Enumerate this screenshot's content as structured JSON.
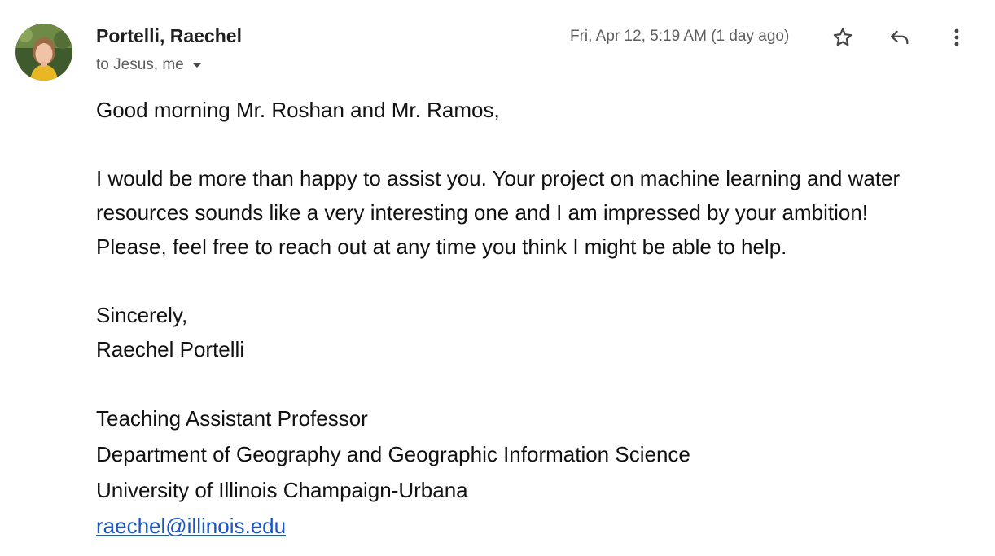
{
  "message": {
    "sender": {
      "name": "Portelli, Raechel",
      "avatar": "profile-photo"
    },
    "recipients": "to Jesus, me",
    "timestamp": "Fri, Apr 12, 5:19 AM (1 day ago)",
    "actions": {
      "star_icon": "star-outline-icon",
      "reply_icon": "reply-arrow-icon",
      "more_icon": "vertical-dots-icon"
    },
    "body": {
      "greeting": "Good morning Mr. Roshan and Mr. Ramos,",
      "paragraph_line1": "I would be more than happy to assist you.  Your project on machine learning and water",
      "paragraph_line2": "resources sounds like a very interesting one and I am impressed by your ambition!",
      "paragraph_line3": "Please, feel free to reach out at any time you think I might be able to help.",
      "closing": "Sincerely,",
      "signature_name": "Raechel Portelli",
      "title": "Teaching Assistant Professor",
      "department": "Department of Geography and Geographic Information Science",
      "university": "University of Illinois Champaign-Urbana",
      "email": "raechel@illinois.edu"
    }
  },
  "colors": {
    "text": "#111111",
    "secondary_text": "#5e5e5e",
    "link": "#1a55c4",
    "icon": "#444746"
  }
}
